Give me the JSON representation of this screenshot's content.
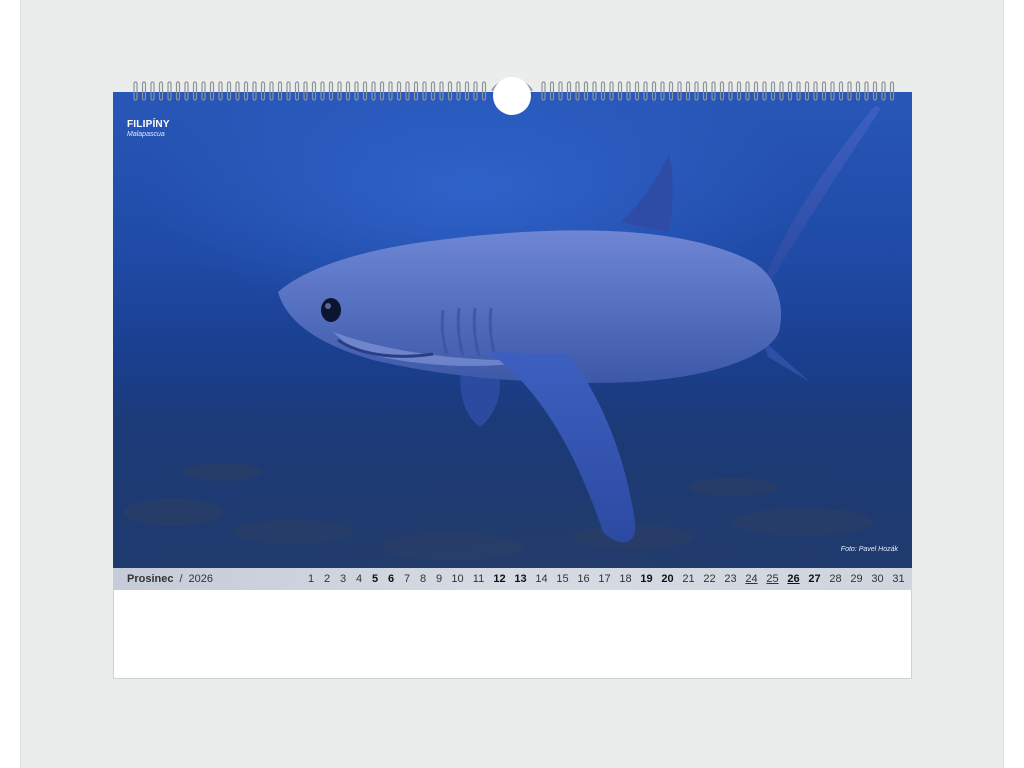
{
  "location": {
    "title": "FILIPÍNY",
    "subtitle": "Malapascua"
  },
  "photo_credit": "Foto: Pavel Hozák",
  "month": {
    "name": "Prosinec",
    "separator": "/",
    "year": "2026"
  },
  "days": [
    {
      "n": "1"
    },
    {
      "n": "2"
    },
    {
      "n": "3"
    },
    {
      "n": "4"
    },
    {
      "n": "5",
      "bold": true
    },
    {
      "n": "6",
      "bold": true
    },
    {
      "n": "7"
    },
    {
      "n": "8"
    },
    {
      "n": "9"
    },
    {
      "n": "10"
    },
    {
      "n": "11"
    },
    {
      "n": "12",
      "bold": true
    },
    {
      "n": "13",
      "bold": true
    },
    {
      "n": "14"
    },
    {
      "n": "15"
    },
    {
      "n": "16"
    },
    {
      "n": "17"
    },
    {
      "n": "18"
    },
    {
      "n": "19",
      "bold": true
    },
    {
      "n": "20",
      "bold": true
    },
    {
      "n": "21"
    },
    {
      "n": "22"
    },
    {
      "n": "23"
    },
    {
      "n": "24",
      "underline": true
    },
    {
      "n": "25",
      "underline": true
    },
    {
      "n": "26",
      "bold": true,
      "underline": true
    },
    {
      "n": "27",
      "bold": true
    },
    {
      "n": "28"
    },
    {
      "n": "29"
    },
    {
      "n": "30"
    },
    {
      "n": "31"
    }
  ],
  "colors": {
    "ocean": "#1f4aa6",
    "shark": "#5a79c9",
    "month_bar": "#cfd5de"
  }
}
